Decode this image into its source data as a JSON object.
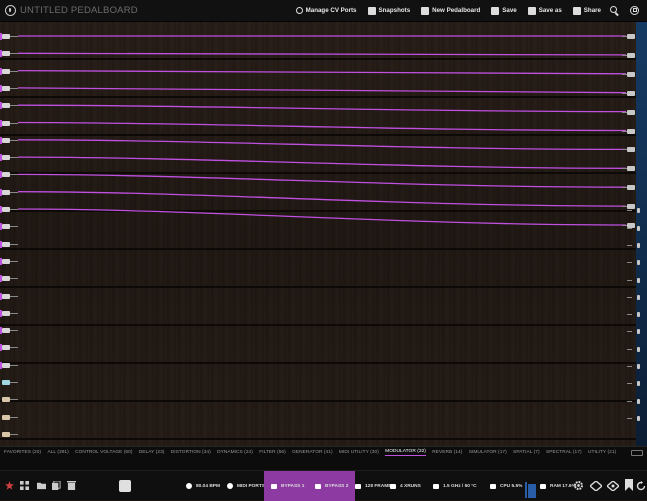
{
  "header": {
    "title": "UNTITLED PEDALBOARD",
    "buttons": [
      {
        "id": "manage-cv",
        "label": "Manage CV Ports"
      },
      {
        "id": "snapshots",
        "label": "Snapshots"
      },
      {
        "id": "new-pedalboard",
        "label": "New Pedalboard"
      },
      {
        "id": "save",
        "label": "Save"
      },
      {
        "id": "save-as",
        "label": "Save as"
      },
      {
        "id": "share",
        "label": "Share"
      }
    ],
    "icons": [
      "search-icon",
      "fullscreen-icon"
    ]
  },
  "colors": {
    "cable": "#bf50e0",
    "accent_purple": "#8d3aa3",
    "topbar": "#111111",
    "wood": "#1e1611",
    "right_strip": "#153a63"
  },
  "categories": [
    {
      "label": "FAVORITES (20)",
      "active": false
    },
    {
      "label": "ALL (391)",
      "active": false
    },
    {
      "label": "CONTROL VOLTAGE (60)",
      "active": false
    },
    {
      "label": "DELAY (23)",
      "active": false
    },
    {
      "label": "DISTORTION (34)",
      "active": false
    },
    {
      "label": "DYNAMICS (24)",
      "active": false
    },
    {
      "label": "FILTER (56)",
      "active": false
    },
    {
      "label": "GENERATOR (41)",
      "active": false
    },
    {
      "label": "MIDI UTILITY (30)",
      "active": false
    },
    {
      "label": "MODULATOR (32)",
      "active": true
    },
    {
      "label": "REVERB (14)",
      "active": false
    },
    {
      "label": "SIMULATOR (17)",
      "active": false
    },
    {
      "label": "SPATIAL (7)",
      "active": false
    },
    {
      "label": "SPECTRAL (17)",
      "active": false
    },
    {
      "label": "UTILITY (21)",
      "active": false
    }
  ],
  "status": {
    "bpm": "80.04 BPM",
    "midi_ports": "MIDI PORTS",
    "bypass1": "BYPASS 1",
    "bypass2": "BYPASS 2",
    "frames": "128 FRAMES",
    "xruns": "4 XRUNS",
    "cpu_freq": "1.5 GHz / 50 °C",
    "cpu": "CPU 5.5%",
    "ram": "RAM 17.6%"
  },
  "connections": {
    "cable_count": 11,
    "input_port_types": [
      "audio",
      "audio",
      "audio",
      "audio",
      "audio",
      "audio",
      "audio",
      "audio",
      "audio",
      "audio",
      "audio",
      "audio",
      "audio",
      "audio",
      "audio",
      "audio",
      "audio",
      "audio",
      "audio",
      "audio",
      "cv",
      "midi",
      "midi",
      "midi"
    ]
  },
  "bottom_icons": [
    "star-icon",
    "grid-icon",
    "folder-icon",
    "copy-icon",
    "trash-icon",
    "cpu-chip-icon",
    "settings-icon",
    "view-icon",
    "view-icon",
    "bookmark-icon",
    "refresh-icon"
  ]
}
